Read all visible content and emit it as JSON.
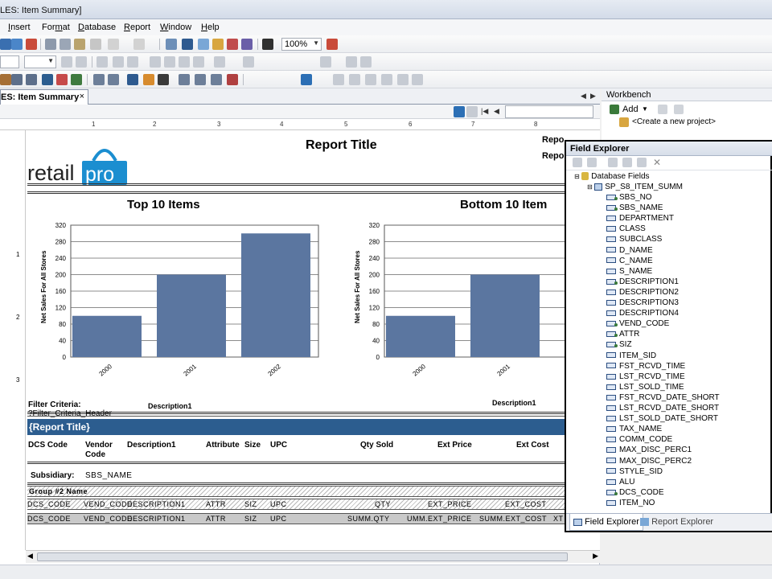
{
  "window": {
    "title": "LES: Item Summary]"
  },
  "menu": [
    {
      "label": "Insert",
      "u": "I",
      "rest": "nsert"
    },
    {
      "label": "Format",
      "u": "m",
      "pre": "For",
      "rest": "at"
    },
    {
      "label": "Database",
      "u": "D",
      "rest": "atabase"
    },
    {
      "label": "Report",
      "u": "R",
      "rest": "eport"
    },
    {
      "label": "Window",
      "u": "W",
      "rest": "indow"
    },
    {
      "label": "Help",
      "u": "H",
      "rest": "elp"
    }
  ],
  "toolbar": {
    "zoom": "100%"
  },
  "doc_tab": {
    "label": "LES: Item Summary",
    "close": "×"
  },
  "report": {
    "title": "Report Title",
    "logo_text": "retailpro",
    "rep_1": "Repo",
    "rep_2": "Repo",
    "filter_label": "Filter Criteria:",
    "filter_value": "?Filter_Criteria_Header",
    "band_title": "{Report Title}",
    "headers": {
      "dcs_code": "DCS Code",
      "vendor_code_1": "Vendor",
      "vendor_code_2": "Code",
      "description1": "Description1",
      "attribute": "Attribute",
      "size": "Size",
      "upc": "UPC",
      "qty_sold": "Qty Sold",
      "ext_price": "Ext Price",
      "ext_cost": "Ext Cost"
    },
    "subsidiary_label": "Subsidiary:",
    "subsidiary_value": "SBS_NAME",
    "group_label": "Group #2 Name",
    "detail_row": {
      "dcs": "DCS_CODE",
      "vend": "VEND_CODE",
      "desc": "DESCRIPTION1",
      "attr": "ATTR",
      "siz": "SIZ",
      "upc": "UPC",
      "qty": "QTY",
      "price": "EXT_PRICE",
      "cost": "EXT_COST"
    },
    "summary_row": {
      "dcs": "DCS_CODE",
      "vend": "VEND_CODE",
      "desc": "DESCRIPTION1",
      "attr": "ATTR",
      "siz": "SIZ",
      "upc": "UPC",
      "qty": "SUMM.QTY",
      "price": "UMM.EXT_PRICE",
      "cost": "SUMM.EXT_COST",
      "extra": "XT"
    }
  },
  "chart_data": [
    {
      "type": "bar",
      "title": "Top 10 Items",
      "xlabel": "Description1",
      "ylabel": "Net Sales For All Stores",
      "categories": [
        "2000",
        "2001",
        "2002"
      ],
      "values": [
        100,
        200,
        300
      ],
      "ylim": [
        0,
        320
      ],
      "yticks": [
        0,
        40,
        80,
        120,
        160,
        200,
        240,
        280,
        320
      ],
      "grid": true,
      "bar_color": "#5b76a0"
    },
    {
      "type": "bar",
      "title": "Bottom 10 Item",
      "xlabel": "Description1",
      "ylabel": "Net Sales For All Stores",
      "categories": [
        "2000",
        "2001"
      ],
      "values": [
        100,
        200
      ],
      "ylim": [
        0,
        320
      ],
      "yticks": [
        0,
        40,
        80,
        120,
        160,
        200,
        240,
        280,
        320
      ],
      "grid": true,
      "bar_color": "#5b76a0"
    }
  ],
  "workbench": {
    "title": "Workbench",
    "add_label": "Add",
    "new_project": "<Create a new project>"
  },
  "field_explorer": {
    "title": "Field Explorer",
    "root": "Database Fields",
    "table": "SP_S8_ITEM_SUMM",
    "fields": [
      {
        "name": "SBS_NO",
        "key": true
      },
      {
        "name": "SBS_NAME",
        "key": true
      },
      {
        "name": "DEPARTMENT",
        "key": false
      },
      {
        "name": "CLASS",
        "key": false
      },
      {
        "name": "SUBCLASS",
        "key": false
      },
      {
        "name": "D_NAME",
        "key": false
      },
      {
        "name": "C_NAME",
        "key": false
      },
      {
        "name": "S_NAME",
        "key": false
      },
      {
        "name": "DESCRIPTION1",
        "key": true
      },
      {
        "name": "DESCRIPTION2",
        "key": false
      },
      {
        "name": "DESCRIPTION3",
        "key": false
      },
      {
        "name": "DESCRIPTION4",
        "key": false
      },
      {
        "name": "VEND_CODE",
        "key": true
      },
      {
        "name": "ATTR",
        "key": true
      },
      {
        "name": "SIZ",
        "key": true
      },
      {
        "name": "ITEM_SID",
        "key": false
      },
      {
        "name": "FST_RCVD_TIME",
        "key": false
      },
      {
        "name": "LST_RCVD_TIME",
        "key": false
      },
      {
        "name": "LST_SOLD_TIME",
        "key": false
      },
      {
        "name": "FST_RCVD_DATE_SHORT",
        "key": false
      },
      {
        "name": "LST_RCVD_DATE_SHORT",
        "key": false
      },
      {
        "name": "LST_SOLD_DATE_SHORT",
        "key": false
      },
      {
        "name": "TAX_NAME",
        "key": false
      },
      {
        "name": "COMM_CODE",
        "key": false
      },
      {
        "name": "MAX_DISC_PERC1",
        "key": false
      },
      {
        "name": "MAX_DISC_PERC2",
        "key": false
      },
      {
        "name": "STYLE_SID",
        "key": false
      },
      {
        "name": "ALU",
        "key": false
      },
      {
        "name": "DCS_CODE",
        "key": true
      },
      {
        "name": "ITEM_NO",
        "key": false
      }
    ],
    "tabs": [
      "Field Explorer",
      "Report Explorer"
    ]
  },
  "colors": {
    "accent": "#2c5d8f",
    "bar": "#5b76a0",
    "logo_blue": "#1b8ed0"
  }
}
